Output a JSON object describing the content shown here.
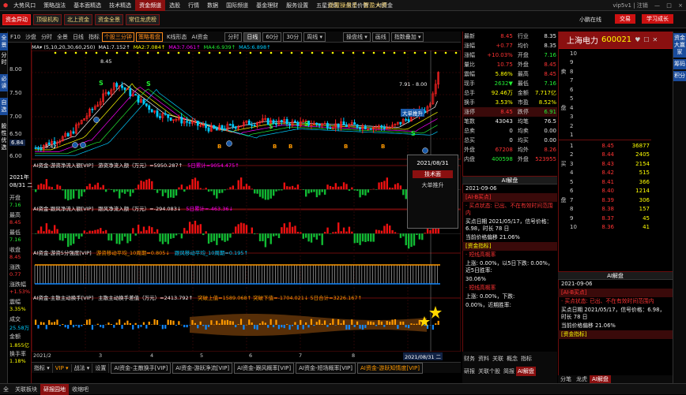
{
  "menubar": {
    "logo": "⬢",
    "items": [
      "大势风口",
      "策略战法",
      "基本面精选",
      "技术精选",
      "资金频道",
      "选股",
      "行情",
      "数据",
      "国际频道",
      "基金理财",
      "服务设置",
      "五星资讯",
      "五星价值",
      "AI资金"
    ],
    "center_title": "益盟操盘手 · 智盈大师",
    "right_user": "vip5v1 | 注销",
    "min": "—",
    "max": "□",
    "close": "×"
  },
  "toolbar": {
    "buttons": [
      "资金异动",
      "顶级机构",
      "北上资金",
      "资金全景",
      "常位龙虎榜"
    ],
    "active": 0,
    "online": "小鹏在线",
    "btn_trade": "交易",
    "btn_learn": "学习成长"
  },
  "leftbar": {
    "tabs": [
      "全景",
      "分时",
      "必读",
      "自选",
      "股性优选"
    ]
  },
  "chartbar": {
    "code": "F10",
    "items": [
      "沙盘",
      "分时",
      "日线",
      "全景",
      "指标"
    ],
    "hi_items": [
      "个股三分钟",
      "策略看盘"
    ],
    "others": [
      "K线形态",
      "AI资金"
    ],
    "periods": [
      "分时",
      "日线",
      "60分",
      "30分",
      "周线 ▾"
    ],
    "period_active": 1,
    "right": [
      "操盘线 ▾",
      "画线",
      "指数叠加 ▾"
    ]
  },
  "ma": {
    "label": "MA▾",
    "params": "(5,10,20,30,60,250)",
    "ma1": "MA1:7.152↑",
    "ma2": "MA2:7.084↑",
    "ma3": "MA3:7.061↑",
    "ma4": "MA4:6.939↑",
    "ma5": "MA5:6.898↑"
  },
  "yaxis": {
    "labels": [
      "8.00",
      "7.50",
      "7.00",
      "6.50",
      "6.00"
    ],
    "cur_price": "6.84",
    "f_date": "2021年",
    "f_date2": "08/31 二",
    "fields": [
      {
        "k": "开盘",
        "v": "7.16",
        "c": "green"
      },
      {
        "k": "最高",
        "v": "8.45",
        "c": "red"
      },
      {
        "k": "最低",
        "v": "7.16",
        "c": "green"
      },
      {
        "k": "收盘",
        "v": "8.45",
        "c": "red"
      },
      {
        "k": "涨跌",
        "v": "0.77",
        "c": "red"
      },
      {
        "k": "涨跌幅",
        "v": "+1.53%",
        "c": "red"
      },
      {
        "k": "震幅",
        "v": "3.35%",
        "c": "yel"
      },
      {
        "k": "成交",
        "v": "25.58万",
        "c": "cyan"
      },
      {
        "k": "金额",
        "v": "1.855亿",
        "c": "yel"
      },
      {
        "k": "换手率",
        "v": "1.18%",
        "c": "yel"
      }
    ]
  },
  "annotations": {
    "high_label": "8.45",
    "range_label": "7.91 - 8.00",
    "low_label": "5.42",
    "big_up": "大单推升",
    "s_mark": "S",
    "b_mark": "B"
  },
  "indicators": [
    {
      "title": "AI资金-游资净流入额[VIP]",
      "formula": "游资净流入额（万元）=5950.287↑",
      "sum": "5日累计=9054.475↑"
    },
    {
      "title": "AI资金-跟风净流入额[VIP]",
      "formula": "跟风净流入额（万元）=-294.083↓",
      "sum": "5日累计=-463.36↓"
    },
    {
      "title": "AI资金-游资5分强度[VIP]",
      "formula": "游资移动平均_10周期=0.805↓",
      "sum": "跟风移动平均_10周期=0.195↑"
    },
    {
      "title": "AI资金-主散主动换手[VIP]",
      "formula": "主散主动换手差值（万元）=2413.792↑",
      "sum": "突破上值=1589.068↑ 突破下值=-1704.021↓ 5日合计=3226.167↑"
    }
  ],
  "xaxis": {
    "labels": [
      "2021/2",
      "3",
      "4",
      "5",
      "6",
      "7",
      "8",
      "2021/08/31 二"
    ]
  },
  "bottom_tabs": [
    "指标 ▾",
    "VIP ▾",
    "战法 ▾",
    "设置",
    "AI资金-主散换手[VIP]",
    "AI资金-游跃净流[VIP]",
    "AI资金-跟风概率[VIP]",
    "AI资金-短场概率[VIP]",
    "AI资金-游跃知情度[VIP]"
  ],
  "popup": {
    "date": "2021/08/31",
    "btn": "技术面",
    "note": "大单推升"
  },
  "quote": {
    "rows": [
      {
        "k": "最新",
        "v": "8.45",
        "vc": "red",
        "k2": "行业",
        "v2": "8.35",
        "v2c": "white"
      },
      {
        "k": "涨幅",
        "v": "+0.77",
        "vc": "red",
        "k2": "均价",
        "v2": "8.35",
        "v2c": "white"
      },
      {
        "k": "涨幅",
        "v": "+10.03%",
        "vc": "red",
        "k2": "开盘",
        "v2": "7.16",
        "v2c": "green"
      },
      {
        "k": "量比",
        "v": "10.75",
        "vc": "red",
        "k2": "外盘",
        "v2": "8.45",
        "v2c": "red"
      },
      {
        "k": "震幅",
        "v": "5.86%",
        "vc": "yel",
        "k2": "最高",
        "v2": "8.45",
        "v2c": "red"
      },
      {
        "k": "现手",
        "v": "2632▼",
        "vc": "green",
        "k2": "最低",
        "v2": "7.16",
        "v2c": "green"
      },
      {
        "k": "总手",
        "v": "92.46万",
        "vc": "yel",
        "k2": "金额",
        "v2": "7.717亿",
        "v2c": "yel"
      },
      {
        "k": "换手",
        "v": "3.53%",
        "vc": "yel",
        "k2": "市盈",
        "v2": "8.52%",
        "v2c": "yel"
      },
      {
        "k": "涨停",
        "v": "8.45",
        "vc": "red",
        "k2": "跌停",
        "v2": "6.91",
        "v2c": "green"
      },
      {
        "k": "笔数",
        "v": "43043",
        "vc": "white",
        "k2": "均笔",
        "v2": "76.5",
        "v2c": "white"
      },
      {
        "k": "总卖",
        "v": "0",
        "vc": "white",
        "k2": "均卖",
        "v2": "0.00",
        "v2c": "white"
      },
      {
        "k": "总买",
        "v": "0",
        "vc": "white",
        "k2": "均买",
        "v2": "0.00",
        "v2c": "white"
      },
      {
        "k": "外盘",
        "v": "67208",
        "vc": "red",
        "k2": "均外",
        "v2": "8.26",
        "v2c": "red"
      },
      {
        "k": "内盘",
        "v": "400598",
        "vc": "green",
        "k2": "外盘",
        "v2": "523955",
        "v2c": "red"
      }
    ]
  },
  "news": {
    "title": "AI解盘",
    "date": "2021-09-06",
    "head1": "[AI-B买点]",
    "l1": "· 买点状态: 已出、不在有效时间范围内",
    "l2": "买点日期 2021/05/17，信号价格：6.98，时长 78 日",
    "l3": "当前价格偏移 21.06%",
    "head2": "[资金指标]",
    "l4": "· 短线高概率",
    "l5": "上涨: 0.00%，以5日下跌: 0.00%，近5日胜率:",
    "l6": "30.06%",
    "l7": "· 短线高概率",
    "l8": "上涨: 0.00%，下跌:",
    "l9": "0.00%，近期胜率:"
  },
  "quote_tabs": [
    "财务",
    "资料",
    "关联",
    "概念",
    "研报",
    "关联个股",
    "简报",
    "龙虎",
    "AI解盘",
    "指标",
    "收藏"
  ],
  "right": {
    "name": "上海电力",
    "code": "600021",
    "ic1": "♥",
    "ic2": "☐",
    "ic3": "✕",
    "sell_label": "卖",
    "buy_label": "买",
    "sell_side": "卖盘",
    "buy_side": "买盘",
    "sell": [
      {
        "p": "",
        "v": ""
      },
      {
        "p": "",
        "v": ""
      },
      {
        "p": "",
        "v": ""
      },
      {
        "p": "",
        "v": ""
      },
      {
        "p": "",
        "v": ""
      },
      {
        "p": "",
        "v": ""
      },
      {
        "p": "",
        "v": ""
      },
      {
        "p": "",
        "v": ""
      },
      {
        "p": "",
        "v": ""
      },
      {
        "p": "",
        "v": ""
      }
    ],
    "buy": [
      {
        "p": "8.45",
        "v": "36877"
      },
      {
        "p": "8.44",
        "v": "2405"
      },
      {
        "p": "8.43",
        "v": "2154"
      },
      {
        "p": "8.42",
        "v": "515"
      },
      {
        "p": "8.41",
        "v": "366"
      },
      {
        "p": "8.40",
        "v": "1214"
      },
      {
        "p": "8.39",
        "v": "306"
      },
      {
        "p": "8.38",
        "v": "157"
      },
      {
        "p": "8.37",
        "v": "45"
      },
      {
        "p": "8.36",
        "v": "41"
      }
    ],
    "tabs": [
      "分笔",
      "龙虎",
      "AI解盘"
    ]
  },
  "farright": {
    "tabs": [
      "资金大赢家",
      "筹码",
      "积分"
    ]
  },
  "statusbar": {
    "items": [
      "全",
      "关联板块",
      "研报园地",
      "收缩吧"
    ]
  }
}
